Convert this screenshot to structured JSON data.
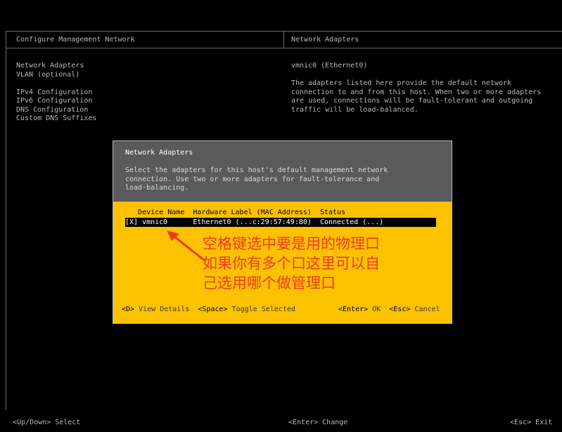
{
  "header": {
    "left_title": "Configure Management Network",
    "right_title": "Network Adapters"
  },
  "menu": {
    "items": [
      "Network Adapters",
      "VLAN (optional)",
      "IPv4 Configuration",
      "IPv6 Configuration",
      "DNS Configuration",
      "Custom DNS Suffixes"
    ]
  },
  "right": {
    "adapter_line": "vmnic0 (Ethernet0)",
    "description": "The adapters listed here provide the default network\nconnection to and from this host. When two or more adapters\nare used, connections will be fault-tolerant and outgoing\ntraffic will be load-balanced."
  },
  "dialog": {
    "title": "Network Adapters",
    "text": "Select the adapters for this host's default management network\nconnection. Use two or more adapters for fault-tolerance and\nload-balancing.",
    "columns": "   Device Name  Hardware Label (MAC Address)  Status",
    "row": "[X] vmnic0      Ethernet0 (...c:29:57:49:80)  Connected (...)",
    "annotation": "空格键选中要是用的物理口\n如果你有多个口这里可以自\n己选用哪个做管理口",
    "keys": {
      "d_key": "<D>",
      "d_label": "View Details",
      "space_key": "<Space>",
      "space_label": "Toggle Selected",
      "enter_key": "<Enter>",
      "enter_label": "OK",
      "esc_key": "<Esc>",
      "esc_label": "Cancel"
    }
  },
  "footer": {
    "left": "<Up/Down> Select",
    "center": "<Enter> Change",
    "right": "<Esc> Exit"
  },
  "colors": {
    "background": "#000000",
    "dialog_top": "#5a5a5a",
    "dialog_bottom": "#fcc200",
    "annotation": "#ee3a25"
  }
}
